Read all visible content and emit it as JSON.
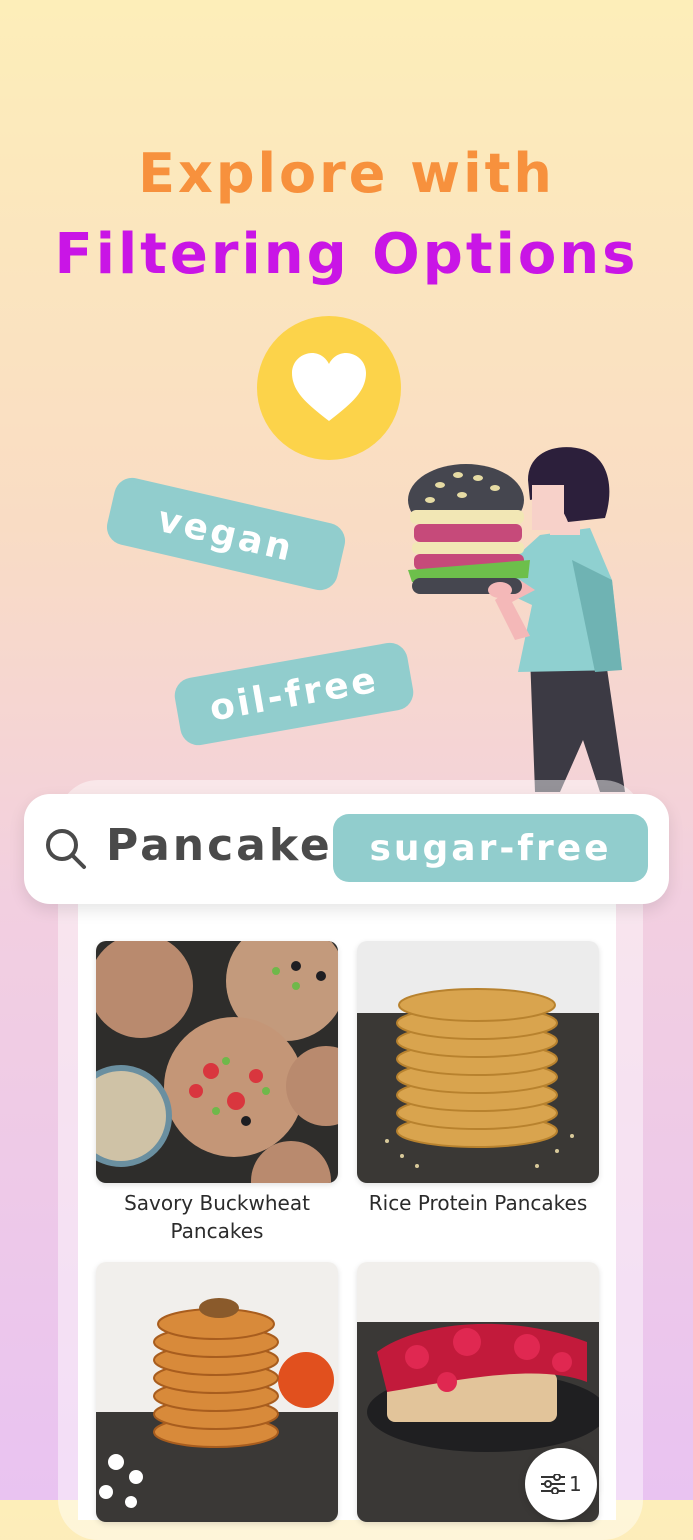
{
  "hero": {
    "line1": "Explore with",
    "line2": "Filtering Options"
  },
  "tags": {
    "vegan": "vegan",
    "oil_free": "oil-free"
  },
  "search": {
    "query": "Pancake",
    "active_filter": "sugar-free"
  },
  "recipes": [
    {
      "title": "Savory Buckwheat Pancakes"
    },
    {
      "title": "Rice Protein Pancakes"
    }
  ],
  "filter_button": {
    "count": "1"
  },
  "colors": {
    "orange": "#f7913d",
    "magenta": "#c915e6",
    "teal_tag": "#91cdcd",
    "heart_circle": "#fcd34a"
  },
  "icons": [
    "heart-icon",
    "search-icon",
    "filter-sliders-icon"
  ]
}
